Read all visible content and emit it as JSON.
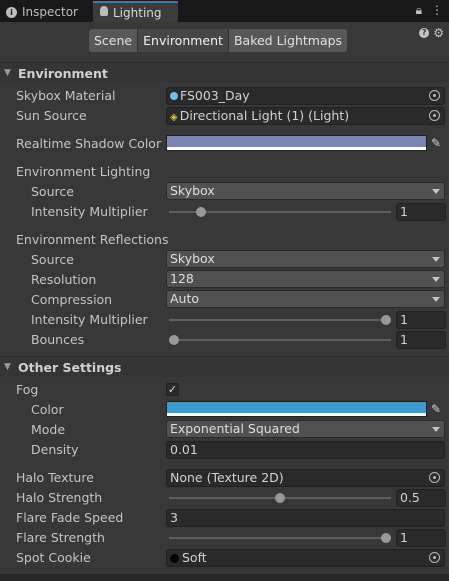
{
  "tabs": {
    "inspector": "Inspector",
    "lighting": "Lighting",
    "lock_icon": "lock-icon",
    "menu_icon": "kebab-menu-icon"
  },
  "toolbar": {
    "segments": [
      "Scene",
      "Environment",
      "Baked Lightmaps"
    ],
    "selected": "Environment"
  },
  "environment": {
    "header": "Environment",
    "skybox_material_label": "Skybox Material",
    "skybox_material_value": "FS003_Day",
    "sun_source_label": "Sun Source",
    "sun_source_value": "Directional Light (1) (Light)",
    "realtime_shadow_color_label": "Realtime Shadow Color",
    "realtime_shadow_color": "#7b85b3",
    "lighting": {
      "header": "Environment Lighting",
      "source_label": "Source",
      "source_value": "Skybox",
      "intensity_label": "Intensity Multiplier",
      "intensity_value": "1",
      "intensity_fraction": 0.125
    },
    "reflections": {
      "header": "Environment Reflections",
      "source_label": "Source",
      "source_value": "Skybox",
      "resolution_label": "Resolution",
      "resolution_value": "128",
      "compression_label": "Compression",
      "compression_value": "Auto",
      "intensity_label": "Intensity Multiplier",
      "intensity_value": "1",
      "intensity_fraction": 1.0,
      "bounces_label": "Bounces",
      "bounces_value": "1",
      "bounces_fraction": 0.0
    }
  },
  "other": {
    "header": "Other Settings",
    "fog_label": "Fog",
    "fog_checked": "✓",
    "color_label": "Color",
    "fog_color": "#3d9bd0",
    "mode_label": "Mode",
    "mode_value": "Exponential Squared",
    "density_label": "Density",
    "density_value": "0.01",
    "halo_texture_label": "Halo Texture",
    "halo_texture_value": "None (Texture 2D)",
    "halo_strength_label": "Halo Strength",
    "halo_strength_value": "0.5",
    "halo_strength_fraction": 0.5,
    "flare_fade_label": "Flare Fade Speed",
    "flare_fade_value": "3",
    "flare_strength_label": "Flare Strength",
    "flare_strength_value": "1",
    "flare_strength_fraction": 1.0,
    "spot_cookie_label": "Spot Cookie",
    "spot_cookie_value": "Soft"
  }
}
